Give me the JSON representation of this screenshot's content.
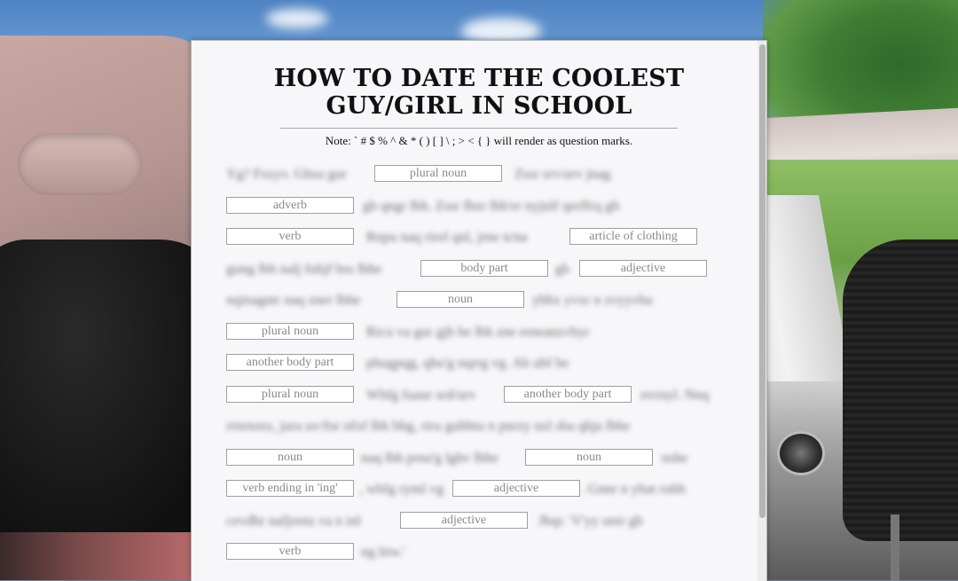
{
  "page": {
    "title_line1": "HOW TO DATE THE COOLEST",
    "title_line2": "GUY/GIRL IN SCHOOL",
    "note": "Note: ` # $ % ^ & * ( ) [ ] \\ ; > < { } will render as question marks."
  },
  "story": {
    "lines": [
      {
        "segments": [
          {
            "text": "Yg? Fsxyv. Ghsu gur"
          },
          {
            "blank": "plural noun"
          },
          {
            "text": "Zssr srv/urv jnag"
          }
        ]
      },
      {
        "segments": [
          {
            "blank": "adverb"
          },
          {
            "text": "gb qngr lbh. Zssr fbzr lbh'er nyjnlf qerffrq gb"
          }
        ]
      },
      {
        "segments": [
          {
            "blank": "verb"
          },
          {
            "text": "Rnpu naq rirel qnl, jrne n/na"
          },
          {
            "blank": "article of clothing"
          }
        ]
      },
      {
        "segments": [
          {
            "text": "gung lbh nalj fuhjf bss lbhe"
          },
          {
            "blank": "body part"
          },
          {
            "text": "gb"
          },
          {
            "blank": "adjective"
          }
        ]
      },
      {
        "segments": [
          {
            "text": "nqinagntr naq zner lbhe"
          },
          {
            "blank": "noun"
          },
          {
            "text": "ybbx yvxr n zvyyvba"
          }
        ]
      },
      {
        "segments": [
          {
            "blank": "plural noun"
          },
          {
            "text": "Ricu va gur gjb be lbh zne erneanzvbyr"
          }
        ]
      },
      {
        "segments": [
          {
            "blank": "another body part"
          },
          {
            "text": "phugpqg, qbu'g nqrrg vg. Ab ubf be"
          }
        ]
      },
      {
        "segments": [
          {
            "blank": "plural noun"
          },
          {
            "text": "Whfg fuaur srd/urv"
          },
          {
            "blank": "another body part"
          },
          {
            "text": "nvrnyl. Nnq"
          }
        ]
      },
      {
        "segments": [
          {
            "text": "rrnrnorz, jura uv/fur nfxf lbh bhg, riru gubhtu n pnrzy nzl sba qhja lbhe"
          }
        ]
      },
      {
        "segments": [
          {
            "blank": "noun"
          },
          {
            "text": "naq lbh prna'g lghv lbhe"
          },
          {
            "blank": "noun"
          },
          {
            "text": "nshe"
          }
        ]
      },
      {
        "segments": [
          {
            "blank": "verb ending in 'ing'"
          },
          {
            "text": ", whfg ryml vg"
          },
          {
            "blank": "adjective"
          },
          {
            "text": ". Gnnr n yhat ruhh"
          }
        ]
      },
      {
        "segments": [
          {
            "text": "cevdbr nafjrenz va n inl"
          },
          {
            "blank": "adjective"
          },
          {
            "text": "Jbqr. 'V'yy unir gb"
          }
        ]
      },
      {
        "segments": [
          {
            "blank": "verb"
          },
          {
            "text": "ng hiw.'"
          }
        ]
      }
    ]
  },
  "colors": {
    "panel": "#f7f7f9",
    "title": "#111111",
    "blank_border": "#9f9f9f",
    "placeholder": "#8a8a8a"
  }
}
